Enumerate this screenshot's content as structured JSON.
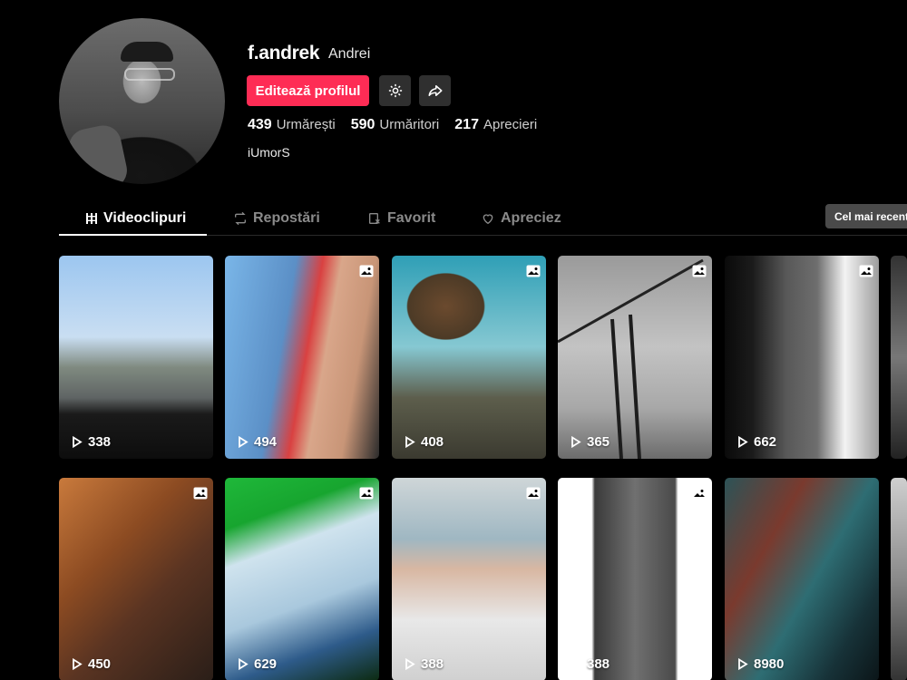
{
  "profile": {
    "username": "f.andrek",
    "nickname": "Andrei",
    "edit_label": "Editează profilul",
    "bio": "iUmorS",
    "stats": [
      {
        "value": "439",
        "label": "Urmărești"
      },
      {
        "value": "590",
        "label": "Urmăritori"
      },
      {
        "value": "217",
        "label": "Aprecieri"
      }
    ]
  },
  "tabs": [
    {
      "label": "Videoclipuri",
      "icon": "grid-icon"
    },
    {
      "label": "Repostări",
      "icon": "repost-icon"
    },
    {
      "label": "Favorit",
      "icon": "bookmark-icon"
    },
    {
      "label": "Apreciez",
      "icon": "heart-icon"
    }
  ],
  "sort_label": "Cel mai recent",
  "videos": [
    {
      "views": "338",
      "photo": false
    },
    {
      "views": "494",
      "photo": true
    },
    {
      "views": "408",
      "photo": true
    },
    {
      "views": "365",
      "photo": true
    },
    {
      "views": "662",
      "photo": true
    },
    {
      "views": "450",
      "photo": true
    },
    {
      "views": "629",
      "photo": true
    },
    {
      "views": "388",
      "photo": true
    },
    {
      "views": "388",
      "photo": true
    },
    {
      "views": "8980",
      "photo": false
    }
  ],
  "colors": {
    "accent": "#fe2c55",
    "background": "#000000"
  }
}
